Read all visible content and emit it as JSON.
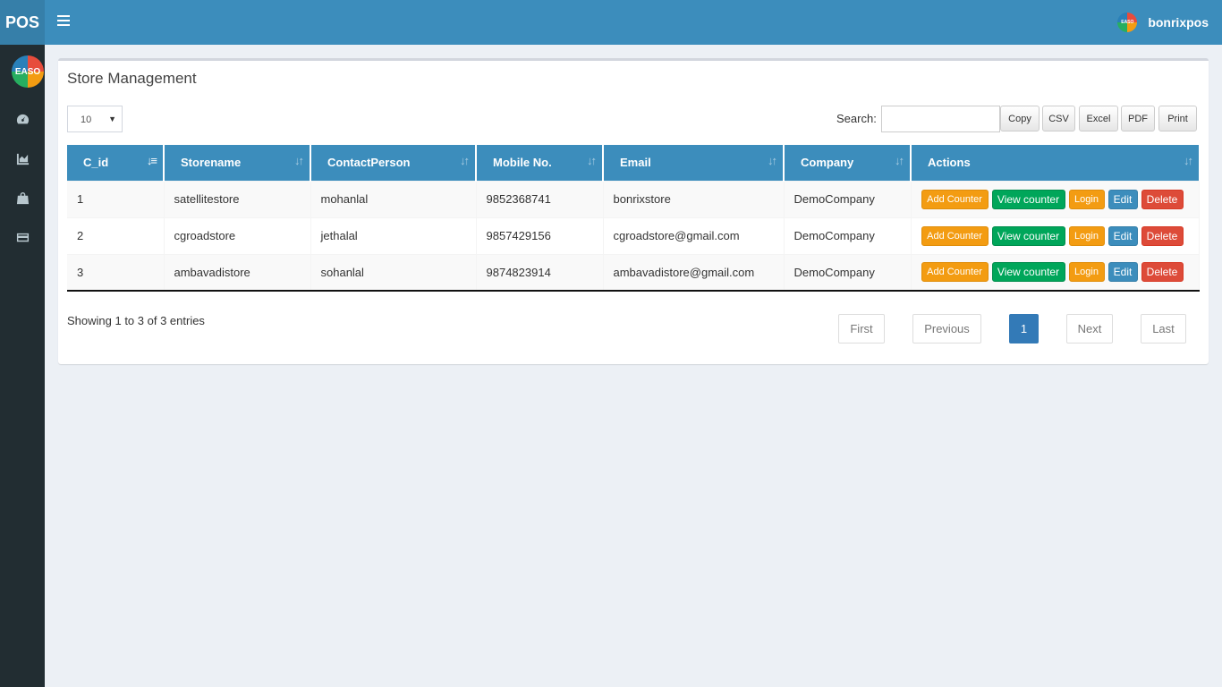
{
  "app": {
    "logo_text": "POS",
    "sidebar_logo_text": "EASO"
  },
  "user": {
    "name": "bonrixpos",
    "avatar_text": "EASO"
  },
  "sidebar": {
    "items": [
      "dashboard-icon",
      "chart-icon",
      "shopping-bag-icon",
      "credit-card-icon"
    ]
  },
  "page": {
    "title": "Store Management"
  },
  "controls": {
    "length_value": "10",
    "search_label": "Search:",
    "search_value": "",
    "export_buttons": {
      "copy": "Copy",
      "csv": "CSV",
      "excel": "Excel",
      "pdf": "PDF",
      "print": "Print"
    }
  },
  "table": {
    "columns": [
      "C_id",
      "Storename",
      "ContactPerson",
      "Mobile No.",
      "Email",
      "Company",
      "Actions"
    ],
    "rows": [
      {
        "c_id": "1",
        "storename": "satellitestore",
        "contact": "mohanlal",
        "mobile": "9852368741",
        "email": "bonrixstore",
        "company": "DemoCompany"
      },
      {
        "c_id": "2",
        "storename": "cgroadstore",
        "contact": "jethalal",
        "mobile": "9857429156",
        "email": "cgroadstore@gmail.com",
        "company": "DemoCompany"
      },
      {
        "c_id": "3",
        "storename": "ambavadistore",
        "contact": "sohanlal",
        "mobile": "9874823914",
        "email": "ambavadistore@gmail.com",
        "company": "DemoCompany"
      }
    ],
    "actions": {
      "add_counter": "Add Counter",
      "view_counter": "View counter",
      "login": "Login",
      "edit": "Edit",
      "delete": "Delete"
    }
  },
  "footer": {
    "info": "Showing 1 to 3 of 3 entries",
    "pagination": {
      "first": "First",
      "previous": "Previous",
      "current": "1",
      "next": "Next",
      "last": "Last"
    }
  },
  "colors": {
    "navbar": "#3c8dbc",
    "logo_bg": "#367fa9",
    "sidebar": "#222d32",
    "orange": "#f39c12",
    "green": "#00a65a",
    "red": "#dd4b39",
    "page_active": "#337ab7"
  }
}
